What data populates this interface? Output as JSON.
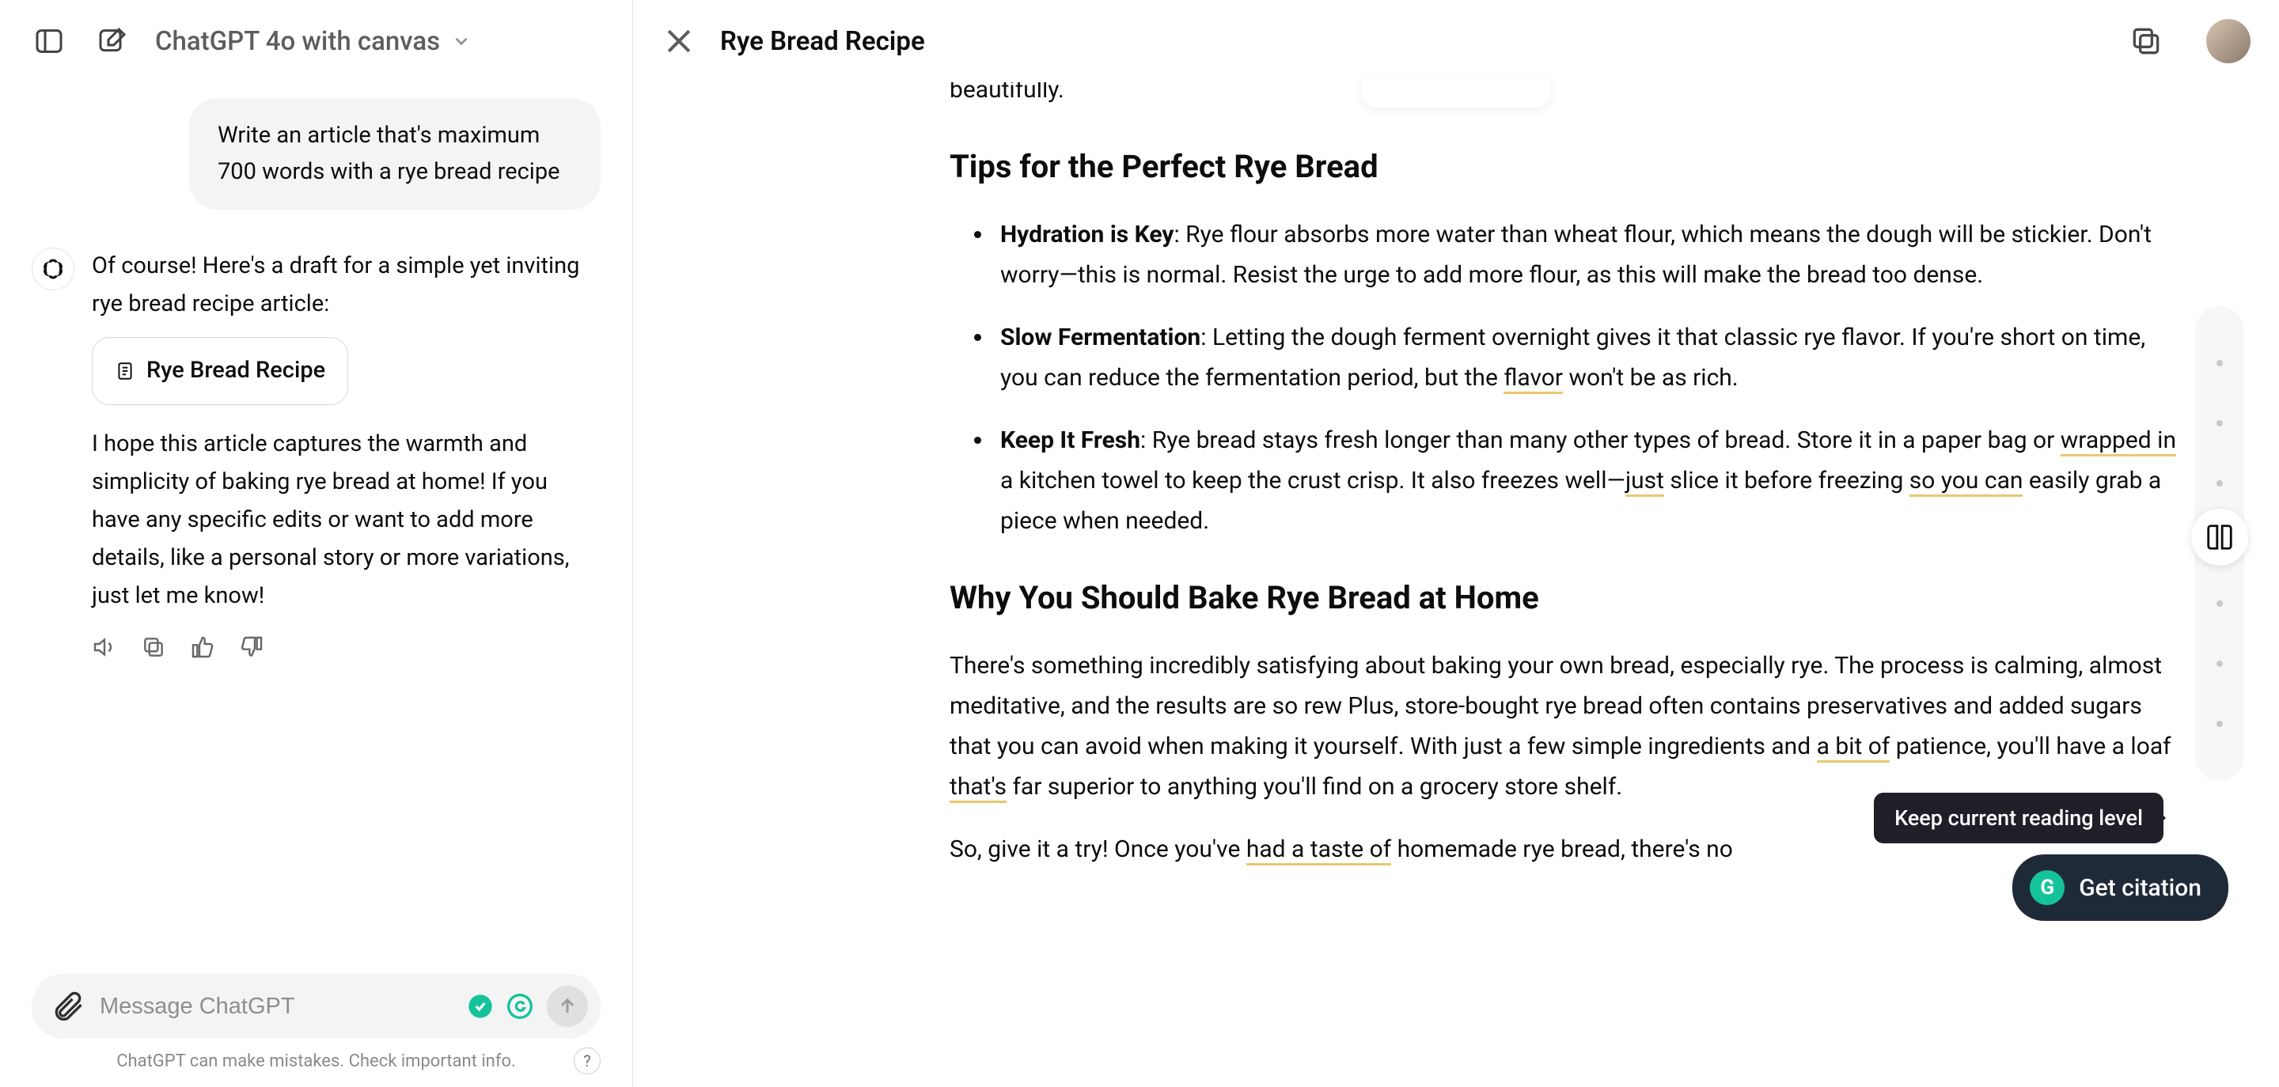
{
  "header": {
    "model_label": "ChatGPT 4o with canvas"
  },
  "chat": {
    "user_message": "Write an article that's maximum 700 words with a rye bread recipe",
    "assistant_intro": "Of course! Here's a draft for a simple yet inviting rye bread recipe article:",
    "doc_chip_label": "Rye Bread Recipe",
    "assistant_followup": "I hope this article captures the warmth and simplicity of baking rye bread at home! If you have any specific edits or want to add more details, like a personal story or more variations, just let me know!",
    "input_placeholder": "Message ChatGPT",
    "disclaimer": "ChatGPT can make mistakes. Check important info.",
    "help_glyph": "?"
  },
  "canvas": {
    "title": "Rye Bread Recipe",
    "truncated_tail": "beautifully.",
    "section_tips_heading": "Tips for the Perfect Rye Bread",
    "tip1_bold": "Hydration is Key",
    "tip1_text": ": Rye flour absorbs more water than wheat flour, which means the dough will be stickier. Don't worry—this is normal. Resist the urge to add more flour, as this will make the bread too dense.",
    "tip2_bold": "Slow Fermentation",
    "tip2_pre": ": Letting the dough ferment overnight gives it that classic rye flavor. If you're short on time, you can reduce the fermentation period, but the ",
    "tip2_u1": "flavor",
    "tip2_post": " won't be as rich.",
    "tip3_bold": "Keep It Fresh",
    "tip3_pre": ": Rye bread stays fresh longer than many other types of bread. Store it in a paper bag or ",
    "tip3_u1": "wrapped in",
    "tip3_mid1": " a kitchen towel to keep the crust crisp. It also freezes well—",
    "tip3_u2": "just",
    "tip3_mid2": " slice it before freezing ",
    "tip3_u3": "so you can",
    "tip3_post": " easily grab a piece when needed.",
    "section_why_heading": "Why You Should Bake Rye Bread at Home",
    "why_pre": "There's something incredibly satisfying about baking your own bread, especially rye. The process is calming, almost meditative, and the results are so rew             Plus, store-bought rye bread often contains preservatives and added sugars that you can avoid when making it yourself. With just a few simple ingredients and ",
    "why_u1": "a bit of",
    "why_mid1": " patience, you'll have a loaf ",
    "why_u2": "that's",
    "why_post": " far superior to anything you'll find on a grocery store shelf.",
    "cta_pre": "So, give it a try! Once you've ",
    "cta_u1": "had a taste of",
    "cta_post": " homemade rye bread, there's no"
  },
  "overlay": {
    "tooltip": "Keep current reading level",
    "citation_label": "Get citation",
    "g_glyph": "G"
  }
}
